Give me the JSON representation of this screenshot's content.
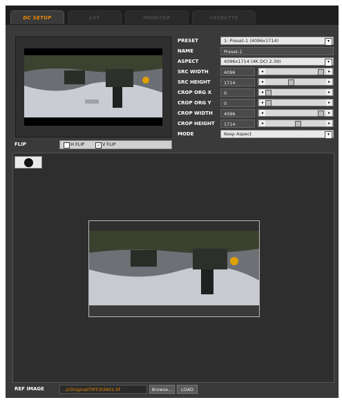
{
  "tabs": [
    {
      "label": "DC SETUP"
    },
    {
      "label": "LUT"
    },
    {
      "label": "MONITOR"
    },
    {
      "label": "CASSETTE"
    }
  ],
  "params": {
    "preset": {
      "label": "PRESET",
      "value": "1: Preset-1 (4096x1714)"
    },
    "name": {
      "label": "NAME",
      "value": "Preset-1"
    },
    "aspect": {
      "label": "ASPECT",
      "value": "4096x1714 (4K DCI 2.39)"
    },
    "src_width": {
      "label": "SRC WIDTH",
      "value": "4096",
      "level": 0.98
    },
    "src_height": {
      "label": "SRC HEIGHT",
      "value": "1714",
      "level": 0.42
    },
    "crop_org_x": {
      "label": "CROP ORG X",
      "value": "0",
      "level": 0.0
    },
    "crop_org_y": {
      "label": "CROP ORG Y",
      "value": "0",
      "level": 0.0
    },
    "crop_width": {
      "label": "CROP WIDTH",
      "value": "4096",
      "level": 0.98
    },
    "crop_height": {
      "label": "CROP HEIGHT",
      "value": "1714",
      "level": 0.55
    },
    "mode": {
      "label": "MODE",
      "value": "Keep Aspect"
    }
  },
  "flip": {
    "label": "FLIP",
    "h_flip": "H FLIP",
    "h_checked": false,
    "v_flip": "V FLIP",
    "v_checked": true
  },
  "ref_image": {
    "label": "REF IMAGE",
    "path": "..2/Original/TIFF/03401.tif",
    "browse": "Browse...",
    "load": "LOAD"
  },
  "colors": {
    "accent": "#f08a00",
    "panel": "#3a3a3a"
  }
}
